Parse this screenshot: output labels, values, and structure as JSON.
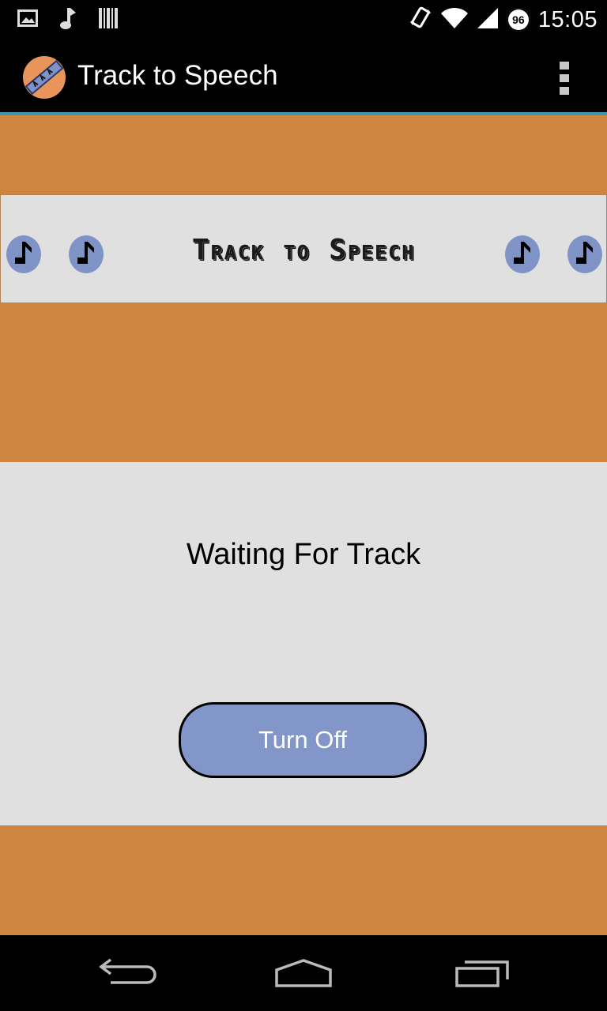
{
  "status_bar": {
    "time": "15:05",
    "battery_level": "96",
    "icons": [
      "image-icon",
      "music-note-icon",
      "barcode-icon",
      "vibrate-icon",
      "wifi-icon",
      "signal-icon",
      "battery-icon"
    ]
  },
  "action_bar": {
    "title": "Track to Speech",
    "app_icon": "app-logo-icon",
    "overflow_icon": "overflow-menu-icon"
  },
  "banner": {
    "text": "Track to Speech",
    "icon": "music-note-icon"
  },
  "main": {
    "status_text": "Waiting For Track",
    "turn_off_label": "Turn Off"
  },
  "nav_bar": {
    "icons": [
      "back-icon",
      "home-icon",
      "recents-icon"
    ]
  },
  "colors": {
    "background": "#cd853f",
    "panel": "#e0e0e0",
    "button": "#8396c9",
    "note_circle": "#8093c6",
    "action_bar_underline": "#3b97b8"
  }
}
